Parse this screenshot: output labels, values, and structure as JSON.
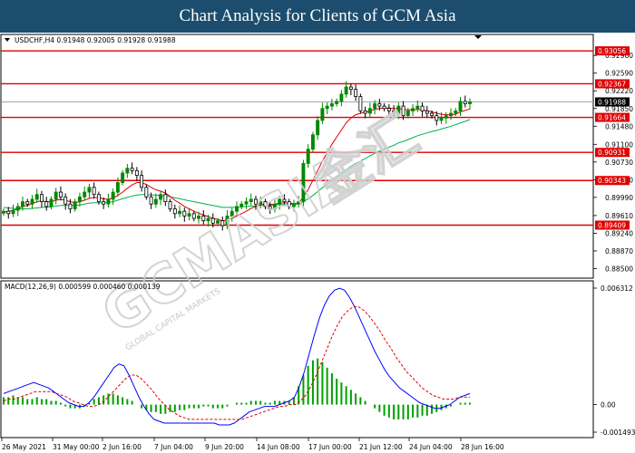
{
  "title": "Chart Analysis for Clients of GCM Asia",
  "chart_data": {
    "type": "candlestick",
    "symbol_header": "USDCHF,H4  0.91948 0.92005 0.91928 0.91988",
    "price_axis": {
      "range": [
        0.883,
        0.934
      ],
      "ticks": [
        "0.92960",
        "0.92590",
        "0.92220",
        "0.91850",
        "0.91480",
        "0.91100",
        "0.90730",
        "0.90360",
        "0.89990",
        "0.89610",
        "0.89240",
        "0.88870",
        "0.88500"
      ],
      "tick_values": [
        0.9296,
        0.9259,
        0.9222,
        0.9185,
        0.9148,
        0.911,
        0.9073,
        0.9036,
        0.8999,
        0.8961,
        0.8924,
        0.8887,
        0.885
      ]
    },
    "levels": [
      {
        "label": "0.93056",
        "value": 0.93056
      },
      {
        "label": "0.92367",
        "value": 0.92367
      },
      {
        "label": "0.91664",
        "value": 0.91664
      },
      {
        "label": "0.90931",
        "value": 0.90931
      },
      {
        "label": "0.90343",
        "value": 0.90343
      },
      {
        "label": "0.89409",
        "value": 0.89409
      }
    ],
    "current_price": {
      "label": "0.91988",
      "value": 0.91988
    },
    "x_ticks": [
      "26 May 2021",
      "31 May 00:00",
      "2 Jun 16:00",
      "7 Jun 04:00",
      "9 Jun 20:00",
      "14 Jun 08:00",
      "17 Jun 00:00",
      "21 Jun 12:00",
      "24 Jun 04:00",
      "28 Jun 16:00"
    ],
    "close_series": [
      0.897,
      0.8965,
      0.8972,
      0.898,
      0.899,
      0.8985,
      0.8995,
      0.9005,
      0.899,
      0.898,
      0.8995,
      0.901,
      0.9,
      0.8985,
      0.8975,
      0.899,
      0.9,
      0.901,
      0.902,
      0.9005,
      0.899,
      0.8985,
      0.8995,
      0.901,
      0.903,
      0.905,
      0.906,
      0.9055,
      0.9045,
      0.902,
      0.9,
      0.8985,
      0.8995,
      0.9005,
      0.899,
      0.8975,
      0.8965,
      0.897,
      0.896,
      0.8965,
      0.8955,
      0.896,
      0.895,
      0.8955,
      0.8945,
      0.895,
      0.894,
      0.896,
      0.897,
      0.898,
      0.8985,
      0.899,
      0.8995,
      0.8985,
      0.899,
      0.898,
      0.8975,
      0.8985,
      0.8995,
      0.899,
      0.898,
      0.8985,
      0.899,
      0.907,
      0.91,
      0.913,
      0.916,
      0.9185,
      0.919,
      0.9195,
      0.92,
      0.9215,
      0.923,
      0.9225,
      0.921,
      0.918,
      0.9175,
      0.9185,
      0.9195,
      0.919,
      0.9185,
      0.918,
      0.9175,
      0.919,
      0.917,
      0.918,
      0.9185,
      0.919,
      0.918,
      0.9175,
      0.917,
      0.916,
      0.9165,
      0.917,
      0.9175,
      0.918,
      0.92,
      0.9195,
      0.9199
    ],
    "ma_red_series": [
      0.8968,
      0.897,
      0.8972,
      0.8975,
      0.898,
      0.8982,
      0.8986,
      0.899,
      0.8992,
      0.899,
      0.899,
      0.8993,
      0.8995,
      0.8993,
      0.899,
      0.8988,
      0.899,
      0.8993,
      0.8997,
      0.8999,
      0.8998,
      0.8996,
      0.8995,
      0.8998,
      0.9003,
      0.901,
      0.9018,
      0.9025,
      0.903,
      0.903,
      0.9026,
      0.902,
      0.9015,
      0.9012,
      0.9008,
      0.9001,
      0.8993,
      0.8987,
      0.898,
      0.8975,
      0.897,
      0.8966,
      0.8962,
      0.8959,
      0.8955,
      0.8953,
      0.895,
      0.8952,
      0.8955,
      0.896,
      0.8965,
      0.897,
      0.8976,
      0.898,
      0.8984,
      0.8985,
      0.8984,
      0.8985,
      0.8987,
      0.8988,
      0.8987,
      0.8986,
      0.8987,
      0.9,
      0.9015,
      0.9035,
      0.9055,
      0.9075,
      0.9093,
      0.911,
      0.9125,
      0.914,
      0.9155,
      0.9165,
      0.9172,
      0.9175,
      0.9177,
      0.918,
      0.9183,
      0.9185,
      0.9186,
      0.9186,
      0.9185,
      0.9185,
      0.9183,
      0.9182,
      0.9182,
      0.9183,
      0.9182,
      0.918,
      0.9178,
      0.9175,
      0.9173,
      0.9172,
      0.9172,
      0.9173,
      0.9178,
      0.9181,
      0.9184
    ],
    "ma_green_series": [
      0.8978,
      0.8977,
      0.8976,
      0.8975,
      0.8975,
      0.8975,
      0.8976,
      0.8977,
      0.8978,
      0.8978,
      0.8979,
      0.8981,
      0.8982,
      0.8982,
      0.8982,
      0.8982,
      0.8983,
      0.8985,
      0.8987,
      0.8988,
      0.8988,
      0.8988,
      0.8989,
      0.899,
      0.8993,
      0.8996,
      0.8999,
      0.9002,
      0.9004,
      0.9005,
      0.9005,
      0.9004,
      0.9004,
      0.9003,
      0.9002,
      0.9,
      0.8998,
      0.8996,
      0.8994,
      0.8992,
      0.899,
      0.8988,
      0.8986,
      0.8984,
      0.8982,
      0.898,
      0.8978,
      0.8978,
      0.8978,
      0.8978,
      0.8979,
      0.898,
      0.8981,
      0.8981,
      0.8982,
      0.8982,
      0.8982,
      0.8983,
      0.8984,
      0.8984,
      0.8984,
      0.8985,
      0.8985,
      0.899,
      0.8996,
      0.9003,
      0.9011,
      0.9019,
      0.9027,
      0.9034,
      0.9041,
      0.9049,
      0.9057,
      0.9064,
      0.907,
      0.9075,
      0.908,
      0.9086,
      0.9091,
      0.9096,
      0.91,
      0.9104,
      0.9108,
      0.9113,
      0.9116,
      0.912,
      0.9124,
      0.9128,
      0.9131,
      0.9134,
      0.9137,
      0.9139,
      0.9142,
      0.9145,
      0.9148,
      0.9151,
      0.9155,
      0.9158,
      0.9162
    ],
    "macd": {
      "header": "MACD(12,26,9) 0.000599 0.000460 0.000139",
      "range": [
        -0.001493,
        0.006312
      ],
      "ticks": [
        "0.006312",
        "0.00",
        "-0.001493"
      ],
      "tick_values": [
        0.006312,
        0.0,
        -0.001493
      ],
      "histogram": [
        0.0004,
        0.0004,
        0.0005,
        0.0004,
        0.0004,
        0.0003,
        0.0003,
        0.0004,
        0.0003,
        0.0003,
        0.0002,
        0.0002,
        0.0001,
        -0.0001,
        -0.0002,
        -0.0002,
        -0.0002,
        -0.0001,
        0.0001,
        0.0003,
        0.0004,
        0.0005,
        0.0006,
        0.0006,
        0.0005,
        0.0004,
        0.0003,
        0.0002,
        0.0,
        -0.0002,
        -0.0003,
        -0.0004,
        -0.0004,
        -0.0005,
        -0.0005,
        -0.0004,
        -0.0004,
        -0.0003,
        -0.0003,
        -0.0002,
        -0.0002,
        -0.0002,
        -0.0001,
        -0.0001,
        -0.0002,
        -0.0002,
        -0.0002,
        -0.0001,
        0.0,
        0.0001,
        0.0001,
        0.0001,
        0.0002,
        0.0002,
        0.0002,
        0.0001,
        0.0001,
        0.0002,
        0.0002,
        0.0002,
        0.0002,
        0.0004,
        0.001,
        0.0016,
        0.0021,
        0.0024,
        0.0025,
        0.0023,
        0.002,
        0.0017,
        0.0014,
        0.0012,
        0.001,
        0.0008,
        0.0006,
        0.0004,
        0.0002,
        0.0,
        -0.0002,
        -0.0004,
        -0.0006,
        -0.0007,
        -0.0008,
        -0.0008,
        -0.0008,
        -0.0008,
        -0.0007,
        -0.0007,
        -0.0006,
        -0.0006,
        -0.0005,
        -0.0004,
        -0.0003,
        -0.0002,
        -0.0001,
        0.0,
        0.0001,
        0.0001,
        0.0001
      ],
      "macd_line": [
        0.0006,
        0.0007,
        0.0008,
        0.0009,
        0.001,
        0.0011,
        0.0012,
        0.0011,
        0.001,
        0.0009,
        0.0007,
        0.0005,
        0.0003,
        0.0001,
        0.0,
        -0.0001,
        -0.0001,
        0.0001,
        0.0004,
        0.0008,
        0.0012,
        0.0016,
        0.002,
        0.0022,
        0.0021,
        0.0016,
        0.001,
        0.0004,
        -0.0001,
        -0.0005,
        -0.0008,
        -0.0009,
        -0.001,
        -0.001,
        -0.001,
        -0.001,
        -0.001,
        -0.001,
        -0.001,
        -0.001,
        -0.001,
        -0.001,
        -0.001,
        -0.0011,
        -0.0011,
        -0.0011,
        -0.001,
        -0.0008,
        -0.0006,
        -0.0004,
        -0.0003,
        -0.0002,
        -0.0001,
        -0.0001,
        -0.0001,
        0.0,
        0.0001,
        0.0002,
        0.0004,
        0.001,
        0.0018,
        0.0028,
        0.0038,
        0.0047,
        0.0054,
        0.0059,
        0.0062,
        0.0063,
        0.0062,
        0.0058,
        0.0053,
        0.0047,
        0.0041,
        0.0035,
        0.0029,
        0.0024,
        0.0019,
        0.0015,
        0.0012,
        0.0009,
        0.0007,
        0.0005,
        0.0003,
        0.0001,
        0.0,
        -0.0001,
        -0.0002,
        -0.0002,
        -0.0001,
        0.0,
        0.0002,
        0.0004,
        0.0005,
        0.0006
      ],
      "signal_line": [
        0.0002,
        0.0003,
        0.0003,
        0.0004,
        0.0005,
        0.0006,
        0.0007,
        0.0007,
        0.0007,
        0.0007,
        0.0006,
        0.0005,
        0.0004,
        0.0002,
        0.0001,
        0.0,
        -0.0001,
        -0.0001,
        0.0,
        0.0002,
        0.0005,
        0.0008,
        0.0011,
        0.0014,
        0.0016,
        0.0016,
        0.0014,
        0.0011,
        0.0008,
        0.0004,
        0.0001,
        -0.0002,
        -0.0004,
        -0.0006,
        -0.0007,
        -0.0008,
        -0.0008,
        -0.0008,
        -0.0008,
        -0.0008,
        -0.0008,
        -0.0008,
        -0.0008,
        -0.0008,
        -0.0008,
        -0.0008,
        -0.0007,
        -0.0006,
        -0.0005,
        -0.0004,
        -0.0003,
        -0.0002,
        -0.0001,
        -0.0001,
        0.0,
        0.0,
        0.0002,
        0.0005,
        0.001,
        0.0016,
        0.0023,
        0.003,
        0.0037,
        0.0043,
        0.0048,
        0.0051,
        0.0053,
        0.0053,
        0.0051,
        0.0048,
        0.0044,
        0.004,
        0.0035,
        0.0031,
        0.0026,
        0.0022,
        0.0018,
        0.0015,
        0.0012,
        0.0009,
        0.0007,
        0.0005,
        0.0004,
        0.0003,
        0.0003,
        0.0003,
        0.0004,
        0.0004,
        0.0004
      ]
    }
  },
  "watermark": {
    "brand": "GCMASIA",
    "chinese": "金汇",
    "tagline": "GLOBAL CAPITAL MARKETS"
  },
  "colors": {
    "title_bg": "#1c4d6e",
    "level": "#e00000",
    "bull": "#008800",
    "bear": "#000000",
    "ma_red": "#e00000",
    "ma_green": "#00b050",
    "macd_line": "#0000ff",
    "signal_line": "#e00000",
    "histogram": "#00a000"
  }
}
